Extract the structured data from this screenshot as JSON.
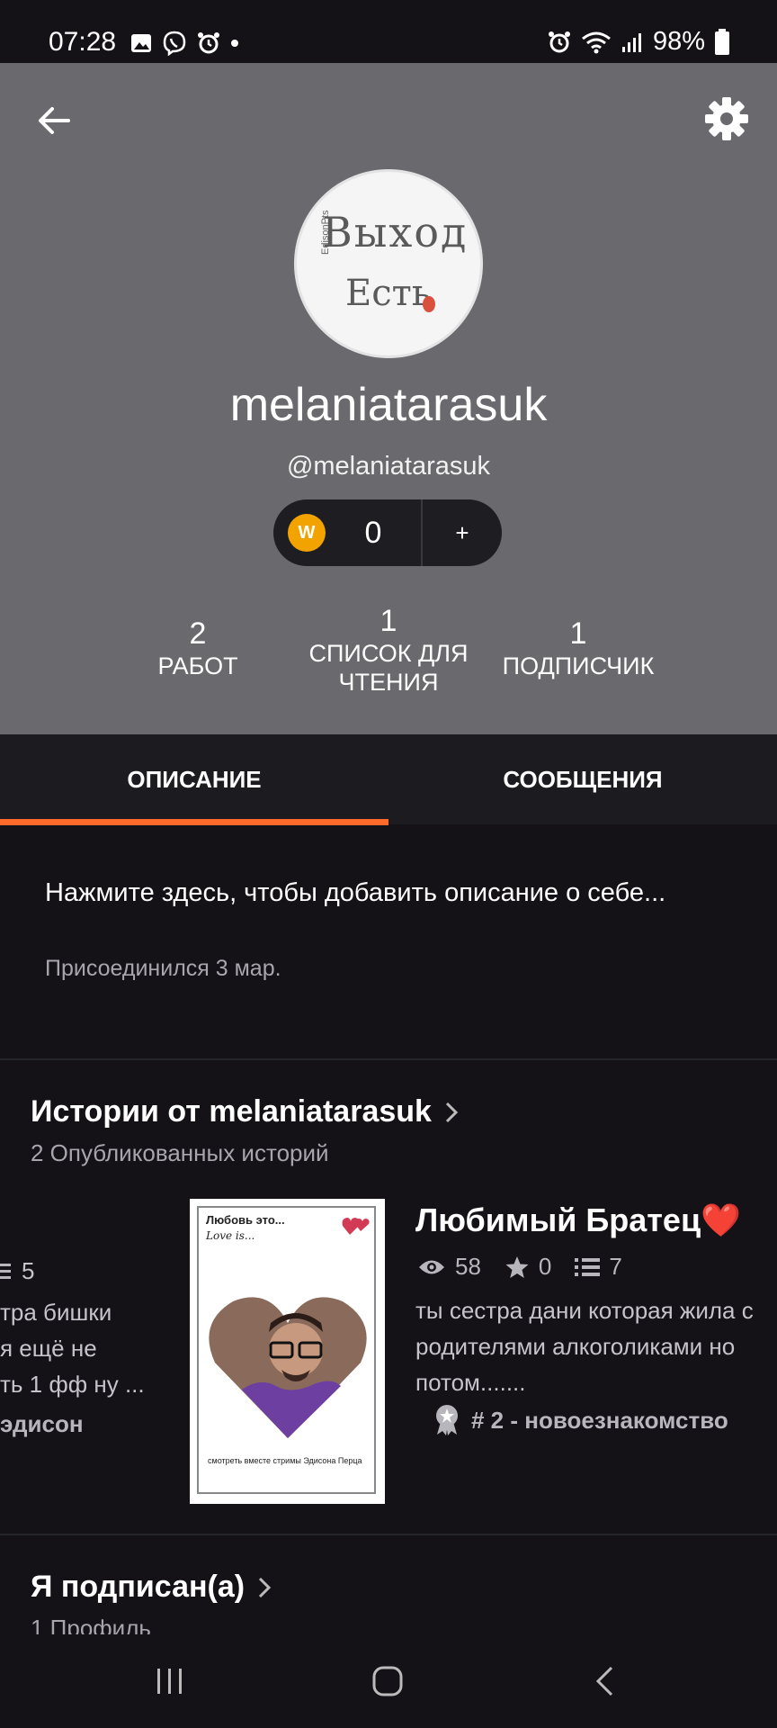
{
  "status_bar": {
    "time": "07:28",
    "battery": "98%"
  },
  "profile": {
    "display_name": "melaniatarasuk",
    "handle": "@melaniatarasuk",
    "coins": "0",
    "coins_add": "+",
    "avatar_text": {
      "line1": "Выход",
      "line2": "Есть",
      "small": "EdisonPts"
    }
  },
  "stats": [
    {
      "value": "2",
      "label": "РАБОТ"
    },
    {
      "value": "1",
      "label": "СПИСОК ДЛЯ ЧТЕНИЯ"
    },
    {
      "value": "1",
      "label": "ПОДПИСЧИК"
    }
  ],
  "tabs": [
    {
      "label": "ОПИСАНИЕ"
    },
    {
      "label": "СООБЩЕНИЯ"
    }
  ],
  "about": {
    "placeholder": "Нажмите здесь, чтобы добавить описание о себе...",
    "joined": "Присоединился 3 мар."
  },
  "stories_section": {
    "title": "Истории от melaniatarasuk",
    "subtitle": "2 Опубликованных историй"
  },
  "left_story": {
    "parts": "5",
    "lines": [
      "тра бишки",
      "я ещё не",
      "ть 1 фф ну ..."
    ],
    "tag": "эдисон"
  },
  "story": {
    "title": "Любимый Братец❤️",
    "reads": "58",
    "votes": "0",
    "parts": "7",
    "description": "ты сестра дани которая жила с родителями алкоголиками но потом.......",
    "tag": "# 2 - новоезнакомство",
    "cover": {
      "line1": "Любовь это...",
      "line2": "Love is...",
      "bottom": "смотреть вместе стримы Эдисона Перца"
    }
  },
  "following_section": {
    "title": "Я подписан(а)",
    "subtitle": "1 Профиль"
  },
  "colors": {
    "header_bg": "#6a696d",
    "accent": "#ff6a2b",
    "background": "#141217"
  }
}
